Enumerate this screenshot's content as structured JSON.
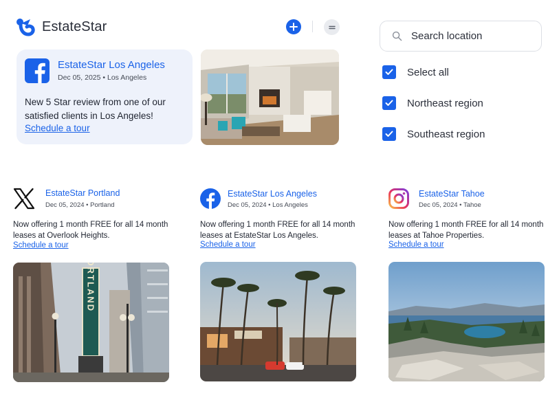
{
  "header": {
    "brand_name": "EstateStar",
    "add_label": "+",
    "menu_label": "menu"
  },
  "search": {
    "placeholder": "Search location"
  },
  "filters": [
    {
      "label": "Select all",
      "checked": true
    },
    {
      "label": "Northeast region",
      "checked": true
    },
    {
      "label": "Southeast region",
      "checked": true
    }
  ],
  "featured_post": {
    "platform_icon": "facebook-icon",
    "account": "EstateStar Los Angeles",
    "date": "Dec 05, 2025",
    "location": "Los Angeles",
    "body": "New 5 Star review from one of our satisfied clients in Los Angeles!",
    "link": "Schedule a tour"
  },
  "posts": [
    {
      "platform_icon": "x-icon",
      "account": "EstateStar Portland",
      "date": "Dec 05, 2024",
      "location": "Portland",
      "body": "Now offering 1 month FREE for all 14 month leases at Overlook Heights.",
      "link": "Schedule a tour"
    },
    {
      "platform_icon": "facebook-icon",
      "account": "EstateStar Los Angeles",
      "date": "Dec 05, 2024",
      "location": "Los Angeles",
      "body": "Now offering 1 month FREE for all 14 month leases at EstateStar Los Angeles.",
      "link": "Schedule a tour"
    },
    {
      "platform_icon": "instagram-icon",
      "account": "EstateStar Tahoe",
      "date": "Dec 05, 2024",
      "location": "Tahoe",
      "body": "Now offering 1 month FREE for all 14 month leases at Tahoe Properties.",
      "link": "Schedule a tour"
    }
  ],
  "photo_sign_text": "PORTLAND",
  "colors": {
    "accent": "#1a62e8",
    "card_bg": "#eef2fb",
    "text": "#1f2430"
  }
}
